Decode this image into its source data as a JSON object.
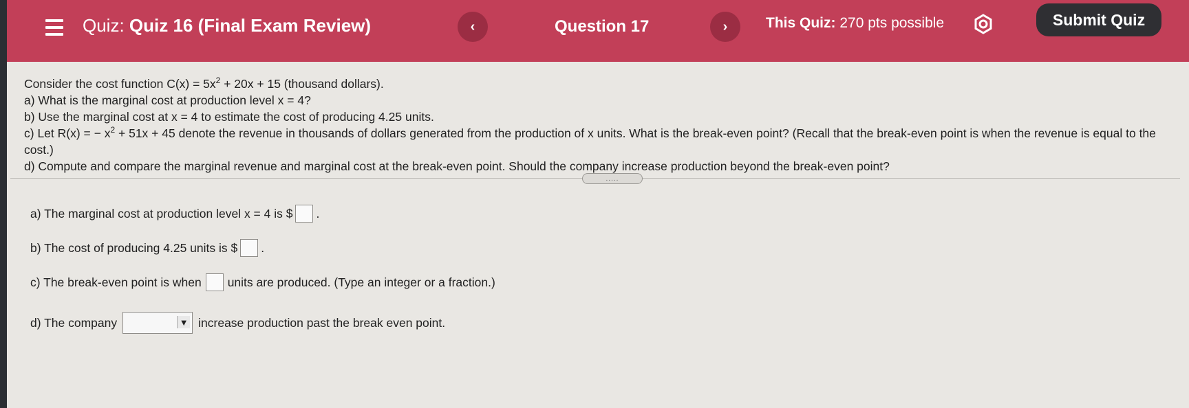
{
  "header": {
    "quiz_label": "Quiz:",
    "quiz_name": "Quiz 16 (Final Exam Review)",
    "prev_icon": "‹",
    "question_label": "Question 17",
    "next_icon": "›",
    "points_label": "This Quiz:",
    "points_value": "270 pts possible",
    "submit_label": "Submit Quiz",
    "colors": {
      "bar": "#c23f58",
      "submit": "#2f2f33"
    }
  },
  "question": {
    "line1_a": "Consider the cost function C(x) = 5x",
    "line1_exp": "2",
    "line1_b": " + 20x + 15 (thousand dollars).",
    "line2": "a) What is the marginal cost at production level x = 4?",
    "line3": "b) Use the marginal cost at x = 4 to estimate the cost of producing 4.25 units.",
    "line4_a": "c) Let R(x) = − x",
    "line4_exp": "2",
    "line4_b": " + 51x + 45 denote the revenue in thousands of dollars generated from the production of x units. What is the break-even point? (Recall that the break-even point is when the revenue is equal to the cost.)",
    "line5": "d) Compute and compare the marginal revenue and marginal cost at the break-even point. Should the company increase production beyond the break-even point?"
  },
  "divider_handle": ".....",
  "answers": {
    "a_prefix": "a) The marginal cost at production level x = 4 is $",
    "a_suffix": ".",
    "b_prefix": "b) The cost of producing 4.25 units is $",
    "b_suffix": ".",
    "c_prefix": "c) The break-even point is when",
    "c_suffix": "units are produced. (Type an integer or a fraction.)",
    "d_prefix": "d) The company",
    "d_arrow": "▼",
    "d_suffix": "increase production past the break even point."
  },
  "icons": {
    "menu": "hamburger-icon",
    "settings": "gear-icon",
    "dropdown": "chevron-down-icon"
  }
}
